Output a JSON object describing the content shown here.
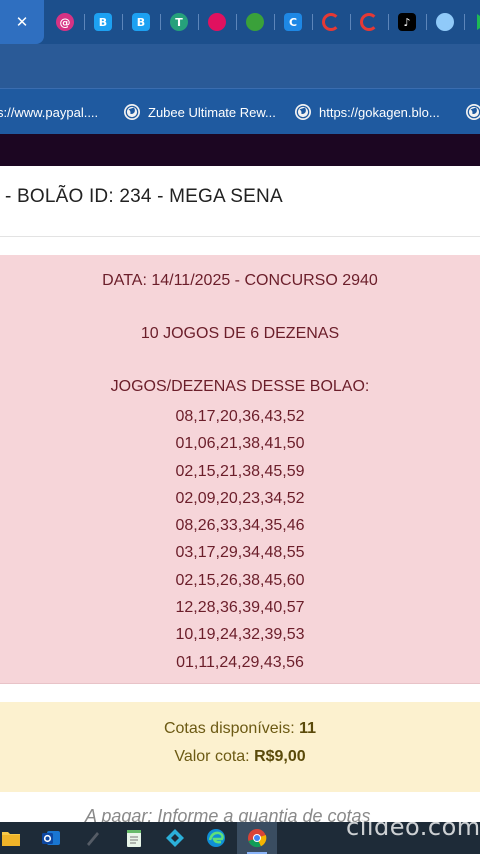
{
  "browser": {
    "tabs": [
      {
        "icon": "at-sign-icon",
        "glyph": "@",
        "color": "#d63384"
      },
      {
        "icon": "bitcoin-icon",
        "glyph": "B",
        "color": "#1da1f2"
      },
      {
        "icon": "bitcoin-icon",
        "glyph": "B",
        "color": "#1da1f2"
      },
      {
        "icon": "tether-icon",
        "glyph": "T",
        "color": "#26a17b"
      },
      {
        "icon": "ruby-icon",
        "glyph": "",
        "color": "#e0115f"
      },
      {
        "icon": "green-circle-icon",
        "glyph": "",
        "color": "#3aa13a"
      },
      {
        "icon": "c-icon",
        "glyph": "C",
        "color": "#1e88e5"
      },
      {
        "icon": "red-arc-icon",
        "glyph": "",
        "color": "#e53935"
      },
      {
        "icon": "red-arc-icon",
        "glyph": "",
        "color": "#e53935"
      },
      {
        "icon": "tiktok-icon",
        "glyph": "♪",
        "color": "#000000"
      },
      {
        "icon": "bird-icon",
        "glyph": "",
        "color": "#90caf9"
      },
      {
        "icon": "play-icon",
        "glyph": "",
        "color": "#1db954"
      }
    ],
    "bookmarks": [
      {
        "label": "s://www.paypal...."
      },
      {
        "label": "Zubee Ultimate Rew..."
      },
      {
        "label": "https://gokagen.blo..."
      }
    ]
  },
  "page": {
    "title": "- BOLÃO ID: 234 - MEGA SENA",
    "info": {
      "date_line": "DATA: 14/11/2025 - CONCURSO 2940",
      "games_count": "10 JOGOS DE 6 DEZENAS",
      "games_header": "JOGOS/DEZENAS DESSE BOLAO:",
      "games": [
        "08,17,20,36,43,52",
        "01,06,21,38,41,50",
        "02,15,21,38,45,59",
        "02,09,20,23,34,52",
        "08,26,33,34,35,46",
        "03,17,29,34,48,55",
        "02,15,26,38,45,60",
        "12,28,36,39,40,57",
        "10,19,24,32,39,53",
        "01,11,24,29,43,56"
      ]
    },
    "quota": {
      "available_label": "Cotas disponíveis:",
      "available_value": "11",
      "price_label": "Valor cota:",
      "price_value": "R$9,00"
    },
    "partial_text": "A pagar:    Informe a quantia de cotas"
  },
  "watermark": "clideo.com",
  "colors": {
    "tab_strip": "#1c4f8c",
    "pink_box": "#f6d5d9",
    "quota_box": "#fcf1cf",
    "site_header": "#1c0622"
  }
}
